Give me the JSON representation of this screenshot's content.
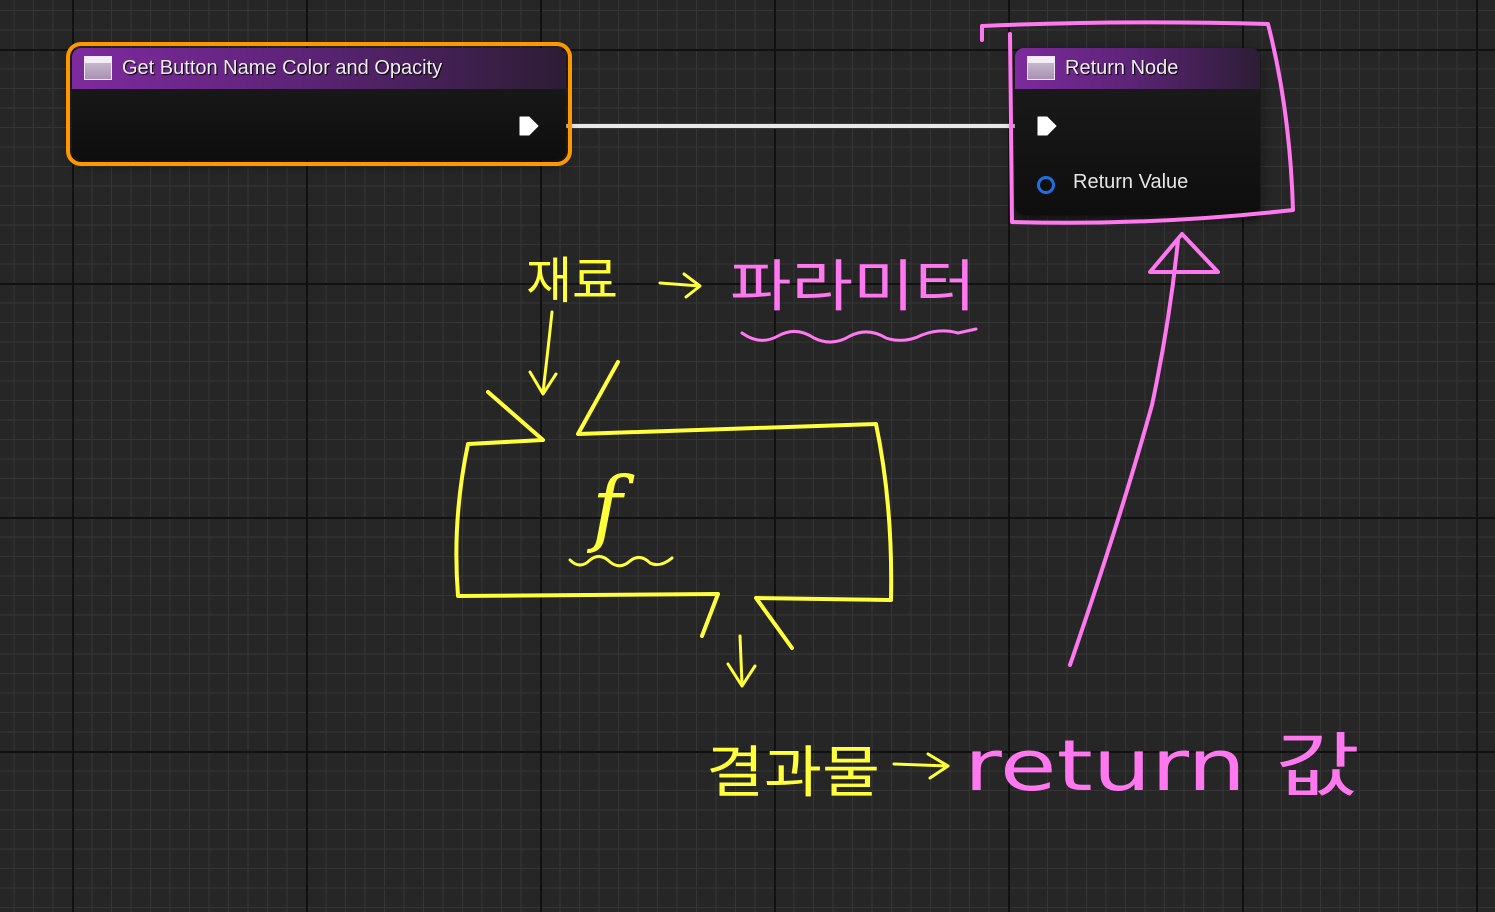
{
  "graph": {
    "function_entry_node": {
      "title": "Get Button Name Color and Opacity",
      "icon": "function-entry-icon"
    },
    "return_node": {
      "title": "Return Node",
      "icon": "function-return-icon",
      "output_label": "Return Value"
    }
  },
  "annotations": {
    "ingredients": "재료",
    "parameter": "파라미터",
    "function_symbol": "f",
    "result": "결과물",
    "return_value": "return 값"
  },
  "colors": {
    "yellow_ink": "#ffff3c",
    "pink_ink": "#ff78f0",
    "selected_node_outline": "#ff9800",
    "exec_wire": "#e8e8e8",
    "value_pin": "#1f6fe0"
  }
}
